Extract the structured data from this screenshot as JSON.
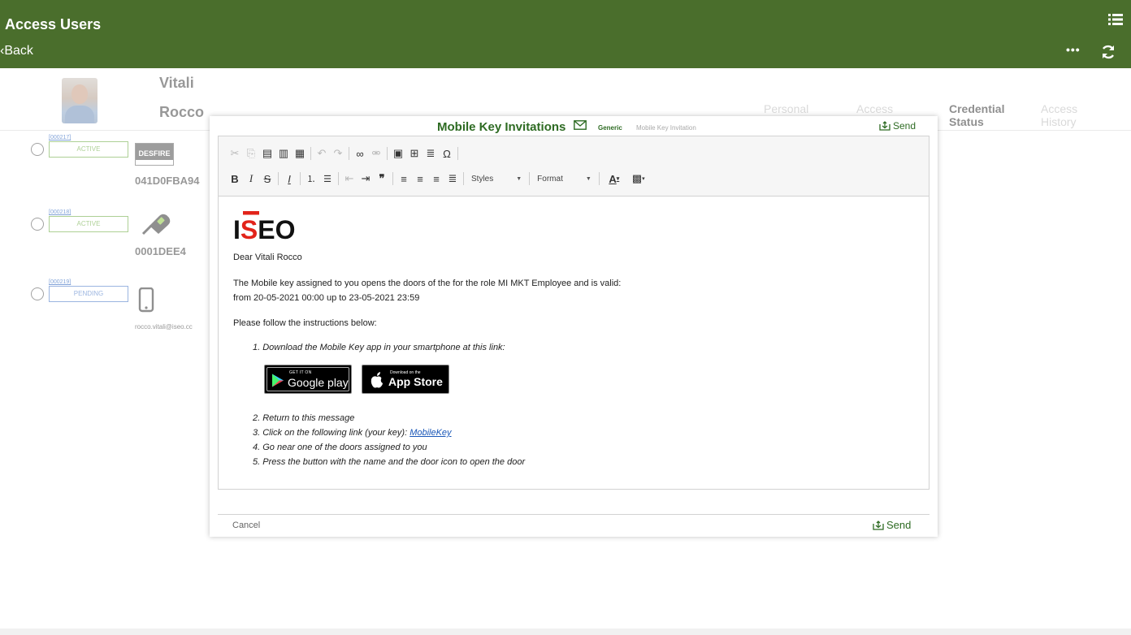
{
  "app": {
    "title": "Access Users",
    "back_label": "Back"
  },
  "user": {
    "first_name": "Vitali",
    "last_name": "Rocco"
  },
  "tabs": [
    {
      "label": "Personal"
    },
    {
      "label": "Access"
    },
    {
      "label": "Credential\nStatus"
    },
    {
      "label": "Access\nHistory"
    }
  ],
  "credentials": [
    {
      "id": "[000217]",
      "status": "ACTIVE",
      "type_badge": "DESFIRE",
      "number": "041D0FBA94"
    },
    {
      "id": "[000218]",
      "status": "ACTIVE",
      "number": "0001DEE4"
    },
    {
      "id": "[000219]",
      "status": "PENDING",
      "email": "rocco.vitali@iseo.cc"
    }
  ],
  "modal": {
    "title": "Mobile Key Invitations",
    "subject_label": "Generic",
    "subject_value": "Mobile Key Invitation",
    "send_label": "Send",
    "cancel_label": "Cancel",
    "toolbar": {
      "styles_label": "Styles",
      "format_label": "Format"
    },
    "letter": {
      "logo_text": "ISEO",
      "greeting": "Dear Vitali Rocco",
      "body_line1": "The Mobile key assigned to you opens the doors of the  for the role MI MKT Employee and is valid:",
      "body_line2": "from 20-05-2021 00:00 up to  23-05-2021 23:59",
      "instructions_intro": "Please follow the instructions below:",
      "step1": "1. Download the Mobile Key app in your smartphone at this link:",
      "step2": "2. Return to this message",
      "step3_prefix": "3. Click on the following link (your key): ",
      "step3_link": "MobileKey",
      "step4": "4. Go near one of the doors assigned to you",
      "step5": "5. Press the button with the name and the door icon to open the door",
      "google_play_small": "GET IT ON",
      "google_play_big": "Google play",
      "app_store_small": "Download on the",
      "app_store_big": "App Store"
    }
  },
  "colors": {
    "header_bg": "#4a6e2c",
    "accent_green": "#2e6b23",
    "active": "#6aaa3f",
    "pending": "#4a78c6",
    "logo_red": "#e2231a"
  }
}
